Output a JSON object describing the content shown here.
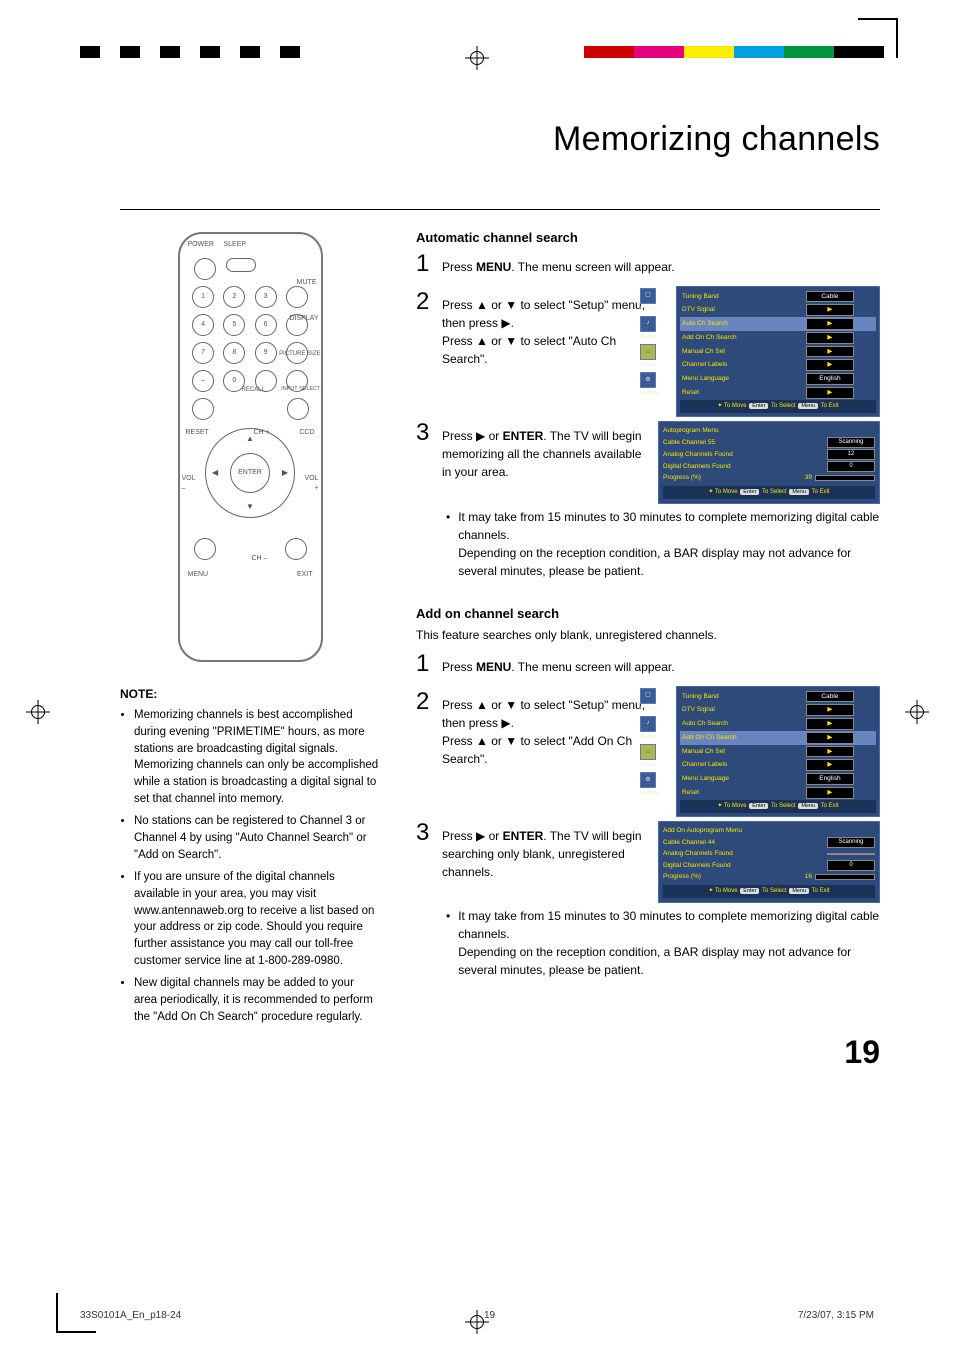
{
  "page": {
    "title": "Memorizing channels",
    "number": "19"
  },
  "sidebar": {
    "note_heading": "NOTE:",
    "notes": [
      "Memorizing channels is best accomplished during evening \"PRIMETIME\" hours, as more stations are broadcasting digital signals. Memorizing channels can only be accomplished while a station is broadcasting a digital signal to set that channel into memory.",
      "No stations can be registered to Channel 3 or Channel 4 by using \"Auto Channel Search\" or \"Add on Search\".",
      "If you are unsure of the digital channels available in your area, you may visit www.antennaweb.org to receive a list based on your address or zip code. Should you require further assistance you may call our toll-free customer service line at 1-800-289-0980.",
      "New digital channels may be added to your area periodically, it is recommended to perform the \"Add On Ch Search\" procedure regularly."
    ]
  },
  "remote": {
    "labels": {
      "power": "POWER",
      "sleep": "SLEEP",
      "mute": "MUTE",
      "display": "DISPLAY",
      "picture_size": "PICTURE SIZE",
      "recall": "RECALL",
      "input_select": "INPUT SELECT",
      "reset": "RESET",
      "ch_plus": "CH +",
      "ch_minus": "CH –",
      "ccd": "CCD",
      "vol_minus": "VOL\n–",
      "vol_plus": "VOL\n+",
      "enter": "ENTER",
      "menu": "MENU",
      "exit": "EXIT"
    },
    "digits": [
      "1",
      "2",
      "3",
      "4",
      "5",
      "6",
      "7",
      "8",
      "9",
      "–",
      "0"
    ]
  },
  "sections": {
    "auto": {
      "heading": "Automatic channel search",
      "steps": {
        "s1": {
          "pre": "Press ",
          "bold": "MENU",
          "post": ".  The menu screen will appear."
        },
        "s2": {
          "line1a": "Press ",
          "line1b": " or ",
          "line1c": " to select \"Setup\" menu, then press ",
          "line2a": "Press ",
          "line2b": " or ",
          "line2c": " to select \"Auto Ch Search\"."
        },
        "s3": {
          "pre": "Press  ",
          "mid": " or ",
          "bold": "ENTER",
          "post": ". The TV will begin memorizing all the channels available in your area."
        },
        "bullet": "It may take from 15 minutes to 30 minutes to complete memorizing digital cable channels.\nDepending on the reception condition, a BAR display may not advance for several minutes, please be patient."
      }
    },
    "addon": {
      "heading": "Add on channel search",
      "intro": "This feature searches only blank, unregistered channels.",
      "steps": {
        "s1": {
          "pre": "Press ",
          "bold": "MENU",
          "post": ". The menu screen will appear."
        },
        "s2": {
          "line1a": "Press ",
          "line1b": " or ",
          "line1c": " to select \"Setup\" menu, then press ",
          "line2a": "Press ",
          "line2b": " or ",
          "line2c": " to select \"Add On Ch Search\"."
        },
        "s3": {
          "pre": "Press  ",
          "mid": " or ",
          "bold": "ENTER",
          "post": ". The TV will begin searching only blank, unregistered channels."
        },
        "bullet": "It may take from 15 minutes to 30 minutes to complete memorizing digital cable channels.\nDepending on the reception condition, a BAR display may not advance for several minutes, please be patient."
      }
    }
  },
  "osd": {
    "tabs": [
      {
        "label": "Picture",
        "icon": "▢"
      },
      {
        "label": "Audio",
        "icon": "♪"
      },
      {
        "label": "Setup",
        "icon": "⌂",
        "selected": true
      },
      {
        "label": "Feature",
        "icon": "⚙"
      }
    ],
    "menu": {
      "rows": [
        {
          "label": "Tuning Band",
          "value": "Cable"
        },
        {
          "label": "DTV Signal",
          "value": "▶",
          "tri": true
        },
        {
          "label": "Auto Ch Search",
          "value": "▶",
          "tri": true,
          "hl_auto": true
        },
        {
          "label": "Add On Ch Search",
          "value": "▶",
          "tri": true,
          "hl_addon": true
        },
        {
          "label": "Manual Ch Set",
          "value": "▶",
          "tri": true
        },
        {
          "label": "Channel Labels",
          "value": "▶",
          "tri": true
        },
        {
          "label": "Menu Language",
          "value": "English"
        },
        {
          "label": "Reset",
          "value": "▶",
          "tri": true
        }
      ]
    },
    "footer": {
      "move_sym": "✦",
      "move": "To Move",
      "enter": "Enter",
      "select": "To Select",
      "menu": "Menu",
      "exit": "To Exit"
    },
    "autoprogram": {
      "title": "Autoprogram Menu",
      "rows": [
        {
          "label": "Cable Channel 55",
          "value": "Scanning"
        },
        {
          "label": "Analog Channels Found",
          "value": "12"
        },
        {
          "label": "Digital Channels Found",
          "value": "0"
        }
      ],
      "progress_label": "Progress (%)",
      "progress_value": "39",
      "progress_pct": 39
    },
    "addon_program": {
      "title": "Add On Autoprogram Menu",
      "rows": [
        {
          "label": "Cable Channel 44",
          "value": "Scanning"
        },
        {
          "label": "Analog Channels Found",
          "value": ""
        },
        {
          "label": "Digital Channels Found",
          "value": "0"
        }
      ],
      "progress_label": "Progress (%)",
      "progress_value": "16",
      "progress_pct": 16
    }
  },
  "footer": {
    "file": "33S0101A_En_p18-24",
    "page": "19",
    "date": "7/23/07, 3:15 PM"
  }
}
